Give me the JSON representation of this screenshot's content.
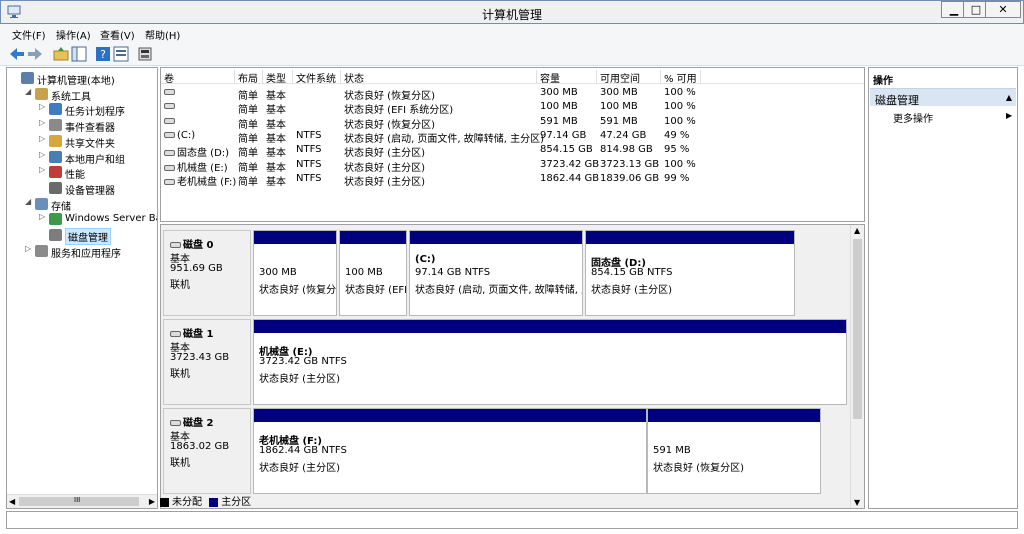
{
  "window": {
    "title": "计算机管理",
    "minimize": "▁",
    "maximize": "□",
    "close": "✕"
  },
  "menu": [
    "文件(F)",
    "操作(A)",
    "查看(V)",
    "帮助(H)"
  ],
  "toolbar_icons": [
    "back-arrow-icon",
    "forward-arrow-icon",
    "folder-up-icon",
    "show-hide-tree-icon",
    "help-icon",
    "properties-icon",
    "disk-settings-icon"
  ],
  "tree": [
    {
      "label": "计算机管理(本地)",
      "arrow": "",
      "icon": "computer-management-icon",
      "indent": 0
    },
    {
      "label": "系统工具",
      "arrow": "◢",
      "icon": "tools-icon",
      "indent": 1
    },
    {
      "label": "任务计划程序",
      "arrow": "▷",
      "icon": "clock-icon",
      "indent": 2
    },
    {
      "label": "事件查看器",
      "arrow": "▷",
      "icon": "event-viewer-icon",
      "indent": 2
    },
    {
      "label": "共享文件夹",
      "arrow": "▷",
      "icon": "shared-folder-icon",
      "indent": 2
    },
    {
      "label": "本地用户和组",
      "arrow": "▷",
      "icon": "users-icon",
      "indent": 2
    },
    {
      "label": "性能",
      "arrow": "▷",
      "icon": "performance-icon",
      "indent": 2
    },
    {
      "label": "设备管理器",
      "arrow": "",
      "icon": "device-manager-icon",
      "indent": 2
    },
    {
      "label": "存储",
      "arrow": "◢",
      "icon": "storage-icon",
      "indent": 1
    },
    {
      "label": "Windows Server Back",
      "arrow": "▷",
      "icon": "backup-icon",
      "indent": 2
    },
    {
      "label": "磁盘管理",
      "arrow": "",
      "icon": "disk-management-icon",
      "indent": 2,
      "selected": true
    },
    {
      "label": "服务和应用程序",
      "arrow": "▷",
      "icon": "services-icon",
      "indent": 1
    }
  ],
  "hscroll_label": "III",
  "volume_columns": [
    "卷",
    "布局",
    "类型",
    "文件系统",
    "状态",
    "容量",
    "可用空间",
    "% 可用"
  ],
  "volumes": [
    [
      "",
      "简单",
      "基本",
      "",
      "状态良好 (恢复分区)",
      "300 MB",
      "300 MB",
      "100 %"
    ],
    [
      "",
      "简单",
      "基本",
      "",
      "状态良好 (EFI 系统分区)",
      "100 MB",
      "100 MB",
      "100 %"
    ],
    [
      "",
      "简单",
      "基本",
      "",
      "状态良好 (恢复分区)",
      "591 MB",
      "591 MB",
      "100 %"
    ],
    [
      "(C:)",
      "简单",
      "基本",
      "NTFS",
      "状态良好 (启动, 页面文件, 故障转储, 主分区)",
      "97.14 GB",
      "47.24 GB",
      "49 %"
    ],
    [
      "固态盘 (D:)",
      "简单",
      "基本",
      "NTFS",
      "状态良好 (主分区)",
      "854.15 GB",
      "814.98 GB",
      "95 %"
    ],
    [
      "机械盘 (E:)",
      "简单",
      "基本",
      "NTFS",
      "状态良好 (主分区)",
      "3723.42 GB",
      "3723.13 GB",
      "100 %"
    ],
    [
      "老机械盘 (F:)",
      "简单",
      "基本",
      "NTFS",
      "状态良好 (主分区)",
      "1862.44 GB",
      "1839.06 GB",
      "99 %"
    ]
  ],
  "disks": [
    {
      "name": "磁盘 0",
      "type": "基本",
      "size": "951.69 GB",
      "status": "联机",
      "partitions": [
        {
          "name": "",
          "size": "300 MB",
          "status": "状态良好 (恢复分"
        },
        {
          "name": "",
          "size": "100 MB",
          "status": "状态良好 (EFI"
        },
        {
          "name": "(C:)",
          "size": "97.14 GB NTFS",
          "status": "状态良好 (启动, 页面文件, 故障转储, 主"
        },
        {
          "name": "固态盘  (D:)",
          "size": "854.15 GB NTFS",
          "status": "状态良好 (主分区)"
        }
      ]
    },
    {
      "name": "磁盘 1",
      "type": "基本",
      "size": "3723.43 GB",
      "status": "联机",
      "partitions": [
        {
          "name": "机械盘  (E:)",
          "size": "3723.42 GB NTFS",
          "status": "状态良好 (主分区)"
        }
      ]
    },
    {
      "name": "磁盘 2",
      "type": "基本",
      "size": "1863.02 GB",
      "status": "联机",
      "partitions": [
        {
          "name": "老机械盘  (F:)",
          "size": "1862.44 GB NTFS",
          "status": "状态良好 (主分区)"
        },
        {
          "name": "",
          "size": "591 MB",
          "status": "状态良好 (恢复分区)"
        }
      ]
    }
  ],
  "legend": {
    "unallocated": "未分配",
    "primary": "主分区",
    "unallocated_color": "#000000",
    "primary_color": "#00007f"
  },
  "actions": {
    "title": "操作",
    "section": "磁盘管理",
    "more": "更多操作"
  }
}
